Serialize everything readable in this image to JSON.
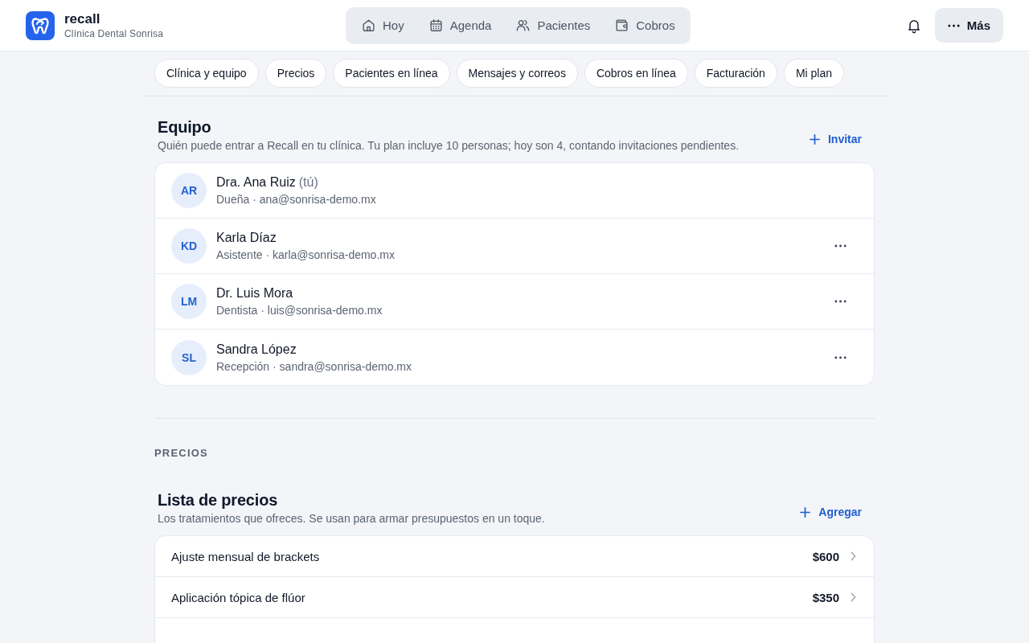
{
  "header": {
    "app_name": "recall",
    "clinic": "Clínica Dental Sonrisa"
  },
  "nav": [
    {
      "label": "Hoy",
      "selected": false
    },
    {
      "label": "Agenda",
      "selected": false
    },
    {
      "label": "Pacientes",
      "selected": false
    },
    {
      "label": "Cobros",
      "selected": false
    }
  ],
  "more_button": {
    "label": "Más",
    "selected": true
  },
  "section_tabs": [
    "Clínica y equipo",
    "Precios",
    "Pacientes en línea",
    "Mensajes y correos",
    "Cobros en línea",
    "Facturación",
    "Mi plan"
  ],
  "team": {
    "title": "Equipo",
    "description": "Quién puede entrar a Recall en tu clínica. Tu plan incluye 10 personas; hoy son 4, contando invitaciones pendientes.",
    "action": "Invitar",
    "members": [
      {
        "initials": "AR",
        "name": "Dra. Ana Ruiz",
        "note": "(tú)",
        "detail": "Dueña · ana@sonrisa-demo.mx",
        "menu": false
      },
      {
        "initials": "KD",
        "name": "Karla Díaz",
        "detail": "Asistente · karla@sonrisa-demo.mx",
        "menu": true
      },
      {
        "initials": "LM",
        "name": "Dr. Luis Mora",
        "detail": "Dentista · luis@sonrisa-demo.mx",
        "menu": true
      },
      {
        "initials": "SL",
        "name": "Sandra López",
        "detail": "Recepción · sandra@sonrisa-demo.mx",
        "menu": true
      }
    ]
  },
  "prices": {
    "group_label": "PRECIOS",
    "title": "Lista de precios",
    "description": "Los tratamientos que ofreces. Se usan para armar presupuestos en un toque.",
    "action": "Agregar",
    "items": [
      {
        "name": "Ajuste mensual de brackets",
        "price": "$600"
      },
      {
        "name": "Aplicación tópica de flúor",
        "price": "$350"
      }
    ]
  }
}
